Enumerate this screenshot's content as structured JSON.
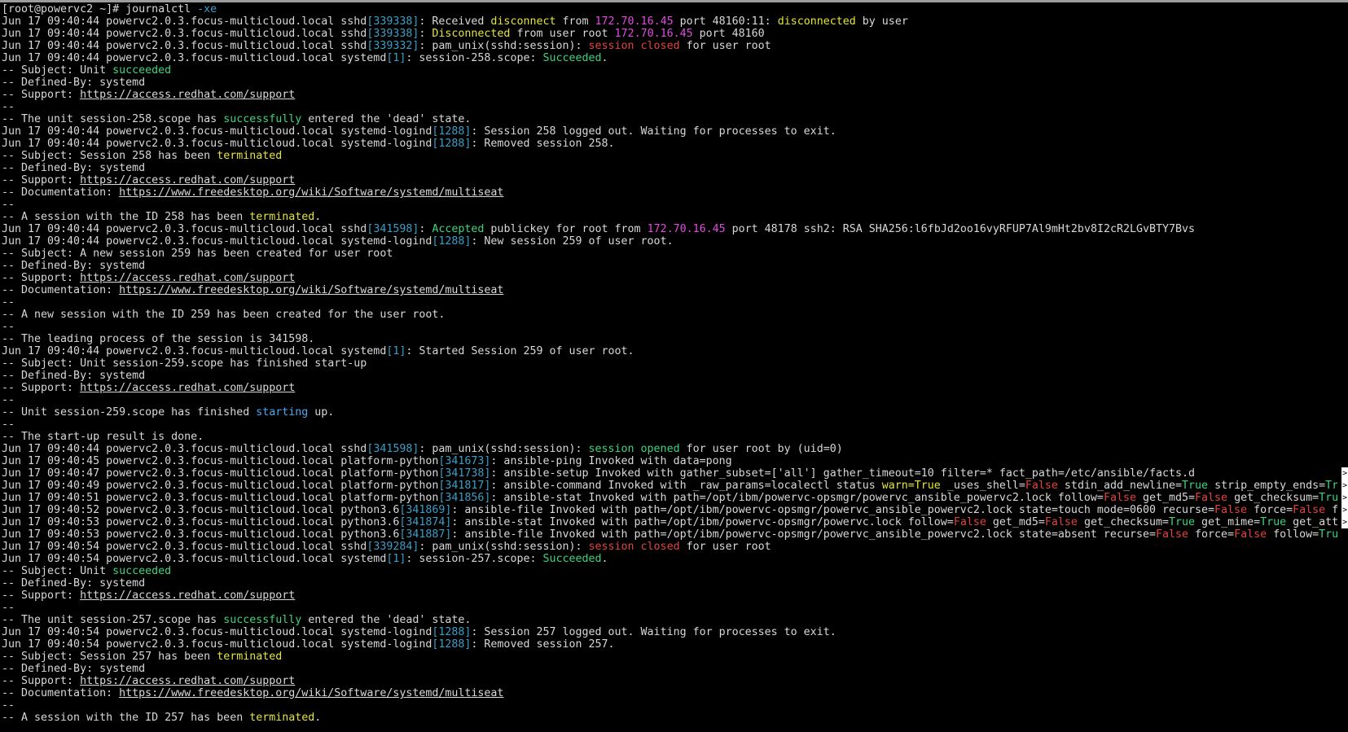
{
  "terminal": {
    "lines": [
      [
        [
          "default",
          "[root@powervc2 ~]# journalctl "
        ],
        [
          "cyan",
          "-xe"
        ]
      ],
      [
        [
          "default",
          "Jun 17 09:40:44 powervc2.0.3.focus-multicloud.local sshd"
        ],
        [
          "cyan",
          "[339338]"
        ],
        [
          "default",
          ": Received "
        ],
        [
          "yellow",
          "disconnect"
        ],
        [
          "default",
          " from "
        ],
        [
          "magenta",
          "172.70.16.45"
        ],
        [
          "default",
          " port 48160:11: "
        ],
        [
          "yellow",
          "disconnected"
        ],
        [
          "default",
          " by user"
        ]
      ],
      [
        [
          "default",
          "Jun 17 09:40:44 powervc2.0.3.focus-multicloud.local sshd"
        ],
        [
          "cyan",
          "[339338]"
        ],
        [
          "default",
          ": "
        ],
        [
          "yellow",
          "Disconnected"
        ],
        [
          "default",
          " from user root "
        ],
        [
          "magenta",
          "172.70.16.45"
        ],
        [
          "default",
          " port 48160"
        ]
      ],
      [
        [
          "default",
          "Jun 17 09:40:44 powervc2.0.3.focus-multicloud.local sshd"
        ],
        [
          "cyan",
          "[339332]"
        ],
        [
          "default",
          ": pam_unix(sshd:session): "
        ],
        [
          "red",
          "session closed"
        ],
        [
          "default",
          " for user root"
        ]
      ],
      [
        [
          "default",
          "Jun 17 09:40:44 powervc2.0.3.focus-multicloud.local systemd"
        ],
        [
          "cyan",
          "[1]"
        ],
        [
          "default",
          ": session-258.scope: "
        ],
        [
          "green",
          "Succeeded"
        ],
        [
          "default",
          "."
        ]
      ],
      [
        [
          "default",
          "-- Subject: Unit "
        ],
        [
          "green",
          "succeeded"
        ]
      ],
      [
        [
          "default",
          "-- Defined-By: systemd"
        ]
      ],
      [
        [
          "default",
          "-- Support: "
        ],
        [
          "link",
          "https://access.redhat.com/support"
        ]
      ],
      [
        [
          "default",
          "--"
        ]
      ],
      [
        [
          "default",
          "-- The unit session-258.scope has "
        ],
        [
          "green",
          "successfully"
        ],
        [
          "default",
          " entered the 'dead' state."
        ]
      ],
      [
        [
          "default",
          "Jun 17 09:40:44 powervc2.0.3.focus-multicloud.local systemd-logind"
        ],
        [
          "cyan",
          "[1288]"
        ],
        [
          "default",
          ": Session 258 logged out. Waiting for processes to exit."
        ]
      ],
      [
        [
          "default",
          "Jun 17 09:40:44 powervc2.0.3.focus-multicloud.local systemd-logind"
        ],
        [
          "cyan",
          "[1288]"
        ],
        [
          "default",
          ": Removed session 258."
        ]
      ],
      [
        [
          "default",
          "-- Subject: Session 258 has been "
        ],
        [
          "yellow",
          "terminated"
        ]
      ],
      [
        [
          "default",
          "-- Defined-By: systemd"
        ]
      ],
      [
        [
          "default",
          "-- Support: "
        ],
        [
          "link",
          "https://access.redhat.com/support"
        ]
      ],
      [
        [
          "default",
          "-- Documentation: "
        ],
        [
          "link",
          "https://www.freedesktop.org/wiki/Software/systemd/multiseat"
        ]
      ],
      [
        [
          "default",
          "--"
        ]
      ],
      [
        [
          "default",
          "-- A session with the ID 258 has been "
        ],
        [
          "yellow",
          "terminated"
        ],
        [
          "default",
          "."
        ]
      ],
      [
        [
          "default",
          "Jun 17 09:40:44 powervc2.0.3.focus-multicloud.local sshd"
        ],
        [
          "cyan",
          "[341598]"
        ],
        [
          "default",
          ": "
        ],
        [
          "green",
          "Accepted"
        ],
        [
          "default",
          " publickey for root from "
        ],
        [
          "magenta",
          "172.70.16.45"
        ],
        [
          "default",
          " port 48178 ssh2: RSA SHA256:l6fbJd2oo16vyRFUP7Al9mHt2bv8I2cR2LGvBTY7Bvs"
        ]
      ],
      [
        [
          "default",
          "Jun 17 09:40:44 powervc2.0.3.focus-multicloud.local systemd-logind"
        ],
        [
          "cyan",
          "[1288]"
        ],
        [
          "default",
          ": New session 259 of user root."
        ]
      ],
      [
        [
          "default",
          "-- Subject: A new session 259 has been created for user root"
        ]
      ],
      [
        [
          "default",
          "-- Defined-By: systemd"
        ]
      ],
      [
        [
          "default",
          "-- Support: "
        ],
        [
          "link",
          "https://access.redhat.com/support"
        ]
      ],
      [
        [
          "default",
          "-- Documentation: "
        ],
        [
          "link",
          "https://www.freedesktop.org/wiki/Software/systemd/multiseat"
        ]
      ],
      [
        [
          "default",
          "--"
        ]
      ],
      [
        [
          "default",
          "-- A new session with the ID 259 has been created for the user root."
        ]
      ],
      [
        [
          "default",
          "--"
        ]
      ],
      [
        [
          "default",
          "-- The leading process of the session is 341598."
        ]
      ],
      [
        [
          "default",
          "Jun 17 09:40:44 powervc2.0.3.focus-multicloud.local systemd"
        ],
        [
          "cyan",
          "[1]"
        ],
        [
          "default",
          ": Started Session 259 of user root."
        ]
      ],
      [
        [
          "default",
          "-- Subject: Unit session-259.scope has finished start-up"
        ]
      ],
      [
        [
          "default",
          "-- Defined-By: systemd"
        ]
      ],
      [
        [
          "default",
          "-- Support: "
        ],
        [
          "link",
          "https://access.redhat.com/support"
        ]
      ],
      [
        [
          "default",
          "--"
        ]
      ],
      [
        [
          "default",
          "-- Unit session-259.scope has finished "
        ],
        [
          "blue",
          "starting"
        ],
        [
          "default",
          " up."
        ]
      ],
      [
        [
          "default",
          "--"
        ]
      ],
      [
        [
          "default",
          "-- The start-up result is done."
        ]
      ],
      [
        [
          "default",
          "Jun 17 09:40:44 powervc2.0.3.focus-multicloud.local sshd"
        ],
        [
          "cyan",
          "[341598]"
        ],
        [
          "default",
          ": pam_unix(sshd:session): "
        ],
        [
          "green",
          "session opened"
        ],
        [
          "default",
          " for user root by (uid=0)"
        ]
      ],
      [
        [
          "default",
          "Jun 17 09:40:45 powervc2.0.3.focus-multicloud.local platform-python"
        ],
        [
          "cyan",
          "[341673]"
        ],
        [
          "default",
          ": ansible-ping Invoked with data=pong"
        ]
      ],
      [
        [
          "default",
          "Jun 17 09:40:47 powervc2.0.3.focus-multicloud.local platform-python"
        ],
        [
          "cyan",
          "[341738]"
        ],
        [
          "default",
          ": ansible-setup Invoked with gather_subset=['all'] gather_timeout=10 filter=* fact_path=/etc/ansible/facts.d"
        ]
      ],
      [
        [
          "default",
          "Jun 17 09:40:49 powervc2.0.3.focus-multicloud.local platform-python"
        ],
        [
          "cyan",
          "[341817]"
        ],
        [
          "default",
          ": ansible-command Invoked with _raw_params=localectl status "
        ],
        [
          "yellow",
          "warn=True"
        ],
        [
          "default",
          " _uses_shell="
        ],
        [
          "red",
          "False"
        ],
        [
          "default",
          " stdin_add_newline="
        ],
        [
          "green",
          "True"
        ],
        [
          "default",
          " strip_empty_ends="
        ],
        [
          "green",
          "Tr"
        ]
      ],
      [
        [
          "default",
          "Jun 17 09:40:51 powervc2.0.3.focus-multicloud.local platform-python"
        ],
        [
          "cyan",
          "[341856]"
        ],
        [
          "default",
          ": ansible-stat Invoked with path=/opt/ibm/powervc-opsmgr/powervc_ansible_powervc2.lock follow="
        ],
        [
          "red",
          "False"
        ],
        [
          "default",
          " get_md5="
        ],
        [
          "red",
          "False"
        ],
        [
          "default",
          " get_checksum="
        ],
        [
          "green",
          "Tru"
        ]
      ],
      [
        [
          "default",
          "Jun 17 09:40:52 powervc2.0.3.focus-multicloud.local python3.6"
        ],
        [
          "cyan",
          "[341869]"
        ],
        [
          "default",
          ": ansible-file Invoked with path=/opt/ibm/powervc-opsmgr/powervc_ansible_powervc2.lock state=touch mode=0600 recurse="
        ],
        [
          "red",
          "False"
        ],
        [
          "default",
          " force="
        ],
        [
          "red",
          "False"
        ],
        [
          "default",
          " f"
        ]
      ],
      [
        [
          "default",
          "Jun 17 09:40:53 powervc2.0.3.focus-multicloud.local python3.6"
        ],
        [
          "cyan",
          "[341874]"
        ],
        [
          "default",
          ": ansible-stat Invoked with path=/opt/ibm/powervc-opsmgr/powervc.lock follow="
        ],
        [
          "red",
          "False"
        ],
        [
          "default",
          " get_md5="
        ],
        [
          "red",
          "False"
        ],
        [
          "default",
          " get_checksum="
        ],
        [
          "green",
          "True"
        ],
        [
          "default",
          " get_mime="
        ],
        [
          "green",
          "True"
        ],
        [
          "default",
          " get_att"
        ]
      ],
      [
        [
          "default",
          "Jun 17 09:40:53 powervc2.0.3.focus-multicloud.local python3.6"
        ],
        [
          "cyan",
          "[341887]"
        ],
        [
          "default",
          ": ansible-file Invoked with path=/opt/ibm/powervc-opsmgr/powervc_ansible_powervc2.lock state=absent recurse="
        ],
        [
          "red",
          "False"
        ],
        [
          "default",
          " force="
        ],
        [
          "red",
          "False"
        ],
        [
          "default",
          " follow="
        ],
        [
          "green",
          "Tru"
        ]
      ],
      [
        [
          "default",
          "Jun 17 09:40:54 powervc2.0.3.focus-multicloud.local sshd"
        ],
        [
          "cyan",
          "[339284]"
        ],
        [
          "default",
          ": pam_unix(sshd:session): "
        ],
        [
          "red",
          "session closed"
        ],
        [
          "default",
          " for user root"
        ]
      ],
      [
        [
          "default",
          "Jun 17 09:40:54 powervc2.0.3.focus-multicloud.local systemd"
        ],
        [
          "cyan",
          "[1]"
        ],
        [
          "default",
          ": session-257.scope: "
        ],
        [
          "green",
          "Succeeded"
        ],
        [
          "default",
          "."
        ]
      ],
      [
        [
          "default",
          "-- Subject: Unit "
        ],
        [
          "green",
          "succeeded"
        ]
      ],
      [
        [
          "default",
          "-- Defined-By: systemd"
        ]
      ],
      [
        [
          "default",
          "-- Support: "
        ],
        [
          "link",
          "https://access.redhat.com/support"
        ]
      ],
      [
        [
          "default",
          "--"
        ]
      ],
      [
        [
          "default",
          "-- The unit session-257.scope has "
        ],
        [
          "green",
          "successfully"
        ],
        [
          "default",
          " entered the 'dead' state."
        ]
      ],
      [
        [
          "default",
          "Jun 17 09:40:54 powervc2.0.3.focus-multicloud.local systemd-logind"
        ],
        [
          "cyan",
          "[1288]"
        ],
        [
          "default",
          ": Session 257 logged out. Waiting for processes to exit."
        ]
      ],
      [
        [
          "default",
          "Jun 17 09:40:54 powervc2.0.3.focus-multicloud.local systemd-logind"
        ],
        [
          "cyan",
          "[1288]"
        ],
        [
          "default",
          ": Removed session 257."
        ]
      ],
      [
        [
          "default",
          "-- Subject: Session 257 has been "
        ],
        [
          "yellow",
          "terminated"
        ]
      ],
      [
        [
          "default",
          "-- Defined-By: systemd"
        ]
      ],
      [
        [
          "default",
          "-- Support: "
        ],
        [
          "link",
          "https://access.redhat.com/support"
        ]
      ],
      [
        [
          "default",
          "-- Documentation: "
        ],
        [
          "link",
          "https://www.freedesktop.org/wiki/Software/systemd/multiseat"
        ]
      ],
      [
        [
          "default",
          "--"
        ]
      ],
      [
        [
          "default",
          "-- A session with the ID 257 has been "
        ],
        [
          "yellow",
          "terminated"
        ],
        [
          "default",
          "."
        ]
      ]
    ],
    "overflow_line_indices": [
      38,
      39,
      40,
      41,
      42
    ],
    "overflow_glyph": ">"
  },
  "colors": {
    "background": "#000000",
    "text": "#d8d8d8",
    "yellow": "#e4e43a",
    "magenta": "#e24ae2",
    "cyan": "#3a9fc6",
    "green": "#3fd37f",
    "red": "#e0443e",
    "blue": "#4aa8f0"
  }
}
